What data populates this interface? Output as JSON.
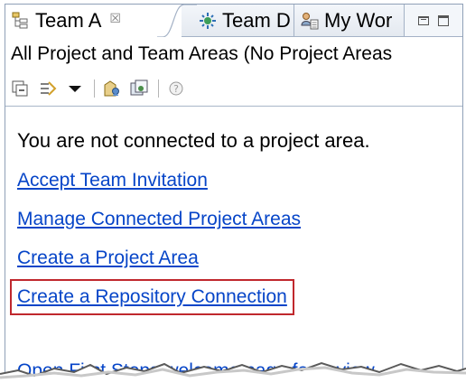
{
  "tabs": [
    {
      "label": "Team A",
      "icon": "team-artifacts-icon",
      "active": true
    },
    {
      "label": "Team D",
      "icon": "team-dashboard-icon",
      "active": false
    },
    {
      "label": "My Wor",
      "icon": "my-work-icon",
      "active": false
    }
  ],
  "close_glyph": "☒",
  "view_title": "All Project and Team Areas (No Project Areas",
  "toolbar": {
    "icons": [
      "collapse-all-icon",
      "link-editor-icon",
      "view-menu-dropdown-icon",
      "new-project-area-icon",
      "manage-areas-icon",
      "help-icon"
    ]
  },
  "content": {
    "status": "You are not connected to a project area.",
    "links": {
      "accept": "Accept Team Invitation",
      "manage": "Manage Connected Project Areas",
      "create_area": "Create a Project Area",
      "create_repo": "Create a Repository Connection",
      "first_steps": "Open First Steps welcome page for review"
    }
  },
  "colors": {
    "link": "#0645c8",
    "highlight": "#c0282d",
    "tab_border": "#a4b2c6"
  }
}
